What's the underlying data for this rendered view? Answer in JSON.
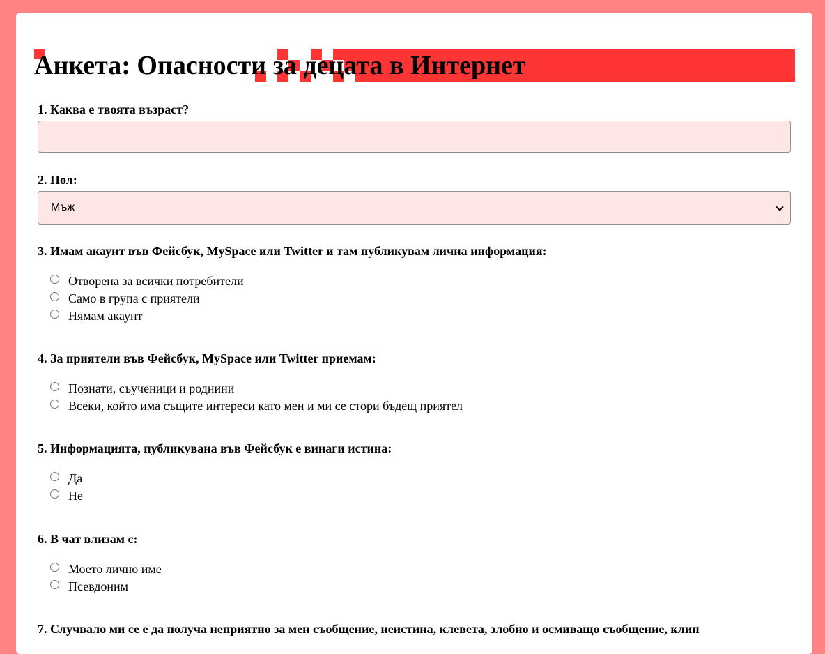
{
  "title": "Анкета: Опасности за децата в Интернет",
  "colors": {
    "page_bg": "#ff8383",
    "accent": "#ff3535",
    "field_bg": "#ffe6e6",
    "card_bg": "#ffffff"
  },
  "questions": [
    {
      "label": "1. Каква е твоята възраст?",
      "type": "text",
      "value": "",
      "placeholder": ""
    },
    {
      "label": "2. Пол:",
      "type": "select",
      "selected": "Мъж",
      "icon": "chevron-down-icon"
    },
    {
      "label": "3. Имам акаунт във Фейсбук, MySpace или Twitter и там публикувам лична информация:",
      "type": "radio",
      "options": [
        "Отворена за всички потребители",
        "Само в група с приятели",
        "Нямам акаунт"
      ]
    },
    {
      "label": "4. За приятели във Фейсбук, MySpace или Twitter приемам:",
      "type": "radio",
      "options": [
        "Познати, съученици и роднини",
        "Всеки, който има същите интереси като мен и ми се стори бъдещ приятел"
      ]
    },
    {
      "label": "5. Информацията, публикувана във Фейсбук е винаги истина:",
      "type": "radio",
      "options": [
        "Да",
        "Не"
      ]
    },
    {
      "label": "6. В чат влизам с:",
      "type": "radio",
      "options": [
        "Моето лично име",
        "Псевдоним"
      ]
    },
    {
      "label": "7. Случвало ми се е да получа неприятно за мен съобщение, неистина, клевета, злобно и осмиващо съобщение, клип",
      "type": "radio",
      "options": []
    }
  ]
}
